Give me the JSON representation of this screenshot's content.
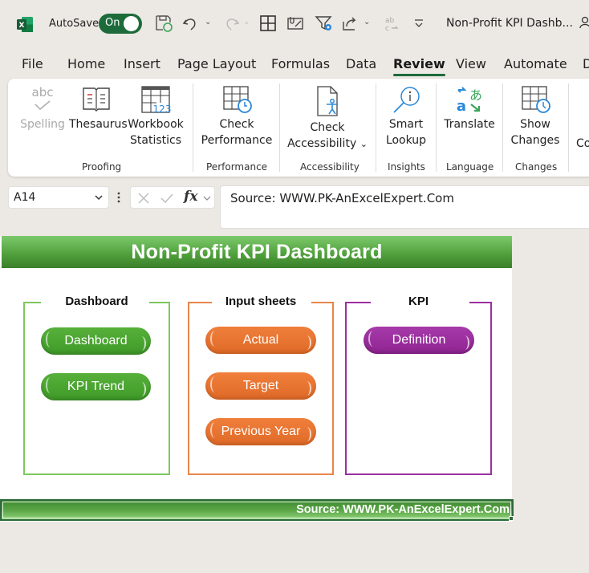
{
  "titlebar": {
    "autosave_label": "AutoSave",
    "autosave_state": "On",
    "doc_title": "Non-Profit KPI Dashb...",
    "icons": [
      "excel-logo-icon",
      "save-sync-icon",
      "undo-icon",
      "redo-icon",
      "borders-icon",
      "form-icon",
      "filter-settings-icon",
      "share-icon",
      "spelling-icon",
      "customize-toolbar-icon",
      "share-people-icon"
    ]
  },
  "tabs": [
    {
      "label": "File"
    },
    {
      "label": "Home"
    },
    {
      "label": "Insert"
    },
    {
      "label": "Page Layout"
    },
    {
      "label": "Formulas"
    },
    {
      "label": "Data"
    },
    {
      "label": "Review",
      "active": true
    },
    {
      "label": "View"
    },
    {
      "label": "Automate"
    },
    {
      "label": "D"
    }
  ],
  "ribbon": {
    "buttons": {
      "spelling": "Spelling",
      "thesaurus": "Thesaurus",
      "workbook_stats_1": "Workbook",
      "workbook_stats_2": "Statistics",
      "check_perf_1": "Check",
      "check_perf_2": "Performance",
      "check_access_1": "Check",
      "check_access_2": "Accessibility",
      "smart_lookup_1": "Smart",
      "smart_lookup_2": "Lookup",
      "translate": "Translate",
      "show_changes_1": "Show",
      "show_changes_2": "Changes",
      "comments_partial": "Co"
    },
    "groups": {
      "proofing": "Proofing",
      "performance": "Performance",
      "accessibility": "Accessibility",
      "insights": "Insights",
      "language": "Language",
      "changes": "Changes"
    }
  },
  "formula_bar": {
    "name_box": "A14",
    "formula": "Source: WWW.PK-AnExcelExpert.Com"
  },
  "sheet": {
    "title": "Non-Profit KPI Dashboard",
    "panels": [
      {
        "title": "Dashboard",
        "color": "#7dc85f",
        "buttons": [
          "Dashboard",
          "KPI Trend"
        ]
      },
      {
        "title": "Input sheets",
        "color": "#e8854a",
        "buttons": [
          "Actual",
          "Target",
          "Previous Year"
        ]
      },
      {
        "title": "KPI",
        "color": "#9b2fa0",
        "buttons": [
          "Definition"
        ]
      }
    ],
    "footer": "Source: WWW.PK-AnExcelExpert.Com",
    "colors": {
      "green": "#4ea236",
      "orange": "#ea7431",
      "purple": "#9a2b9d",
      "header": "#4e9e3a"
    }
  }
}
